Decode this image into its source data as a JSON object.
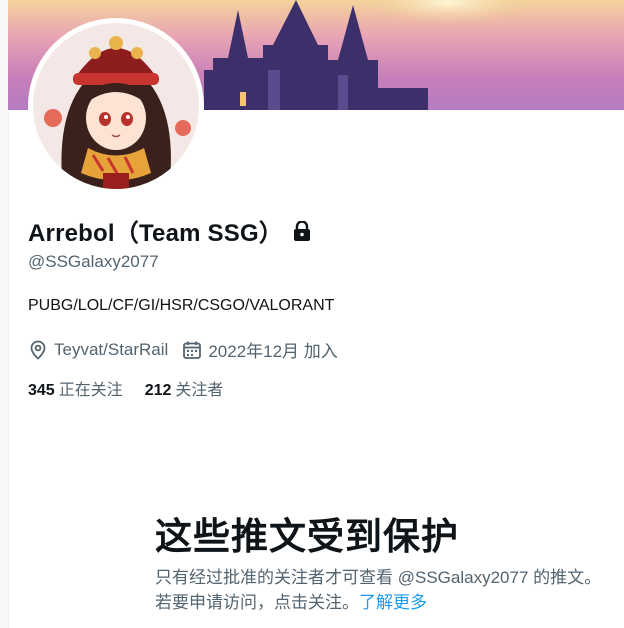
{
  "profile": {
    "display_name": "Arrebol（Team SSG）",
    "handle": "@SSGalaxy2077",
    "bio": "PUBG/LOL/CF/GI/HSR/CSGO/VALORANT",
    "location": "Teyvat/StarRail",
    "joined": "2022年12月 加入",
    "following_count": "345",
    "following_label": "正在关注",
    "followers_count": "212",
    "followers_label": "关注者",
    "icons": {
      "lock": "lock-icon",
      "location": "location-pin-icon",
      "calendar": "calendar-icon"
    }
  },
  "protected": {
    "title": "这些推文受到保护",
    "desc_prefix": "只有经过批准的关注者才可查看",
    "desc_handle": "@SSGalaxy2077",
    "desc_suffix": "的推文。若要申请访问，点击关注。",
    "learn_more": "了解更多"
  },
  "colors": {
    "accent": "#1d9bf0",
    "secondary_text": "#536471",
    "primary_text": "#0f1419"
  }
}
